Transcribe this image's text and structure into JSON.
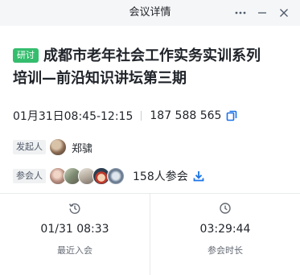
{
  "window": {
    "title": "会议详情",
    "more_icon": "more-horizontal-icon",
    "minimize_icon": "minimize-icon",
    "close_icon": "close-icon"
  },
  "meeting": {
    "badge": "研讨",
    "badge_color": "#35bd6e",
    "title_line1": "成都市老年社会工作实务实训系列",
    "title_line2": "培训—前沿知识讲坛第三期",
    "time": "01月31日08:45-12:15",
    "meeting_id": "187 588 565",
    "copy_icon": "copy-icon",
    "accent_color": "#1a73e8"
  },
  "host": {
    "tag": "发起人",
    "name": "郑骕"
  },
  "attendees": {
    "tag": "参会人",
    "count_text": "158人参会",
    "download_icon": "download-icon"
  },
  "stats": [
    {
      "icon": "history-icon",
      "value": "01/31 08:33",
      "label": "最近入会"
    },
    {
      "icon": "clock-icon",
      "value": "03:29:44",
      "label": "参会时长"
    }
  ]
}
